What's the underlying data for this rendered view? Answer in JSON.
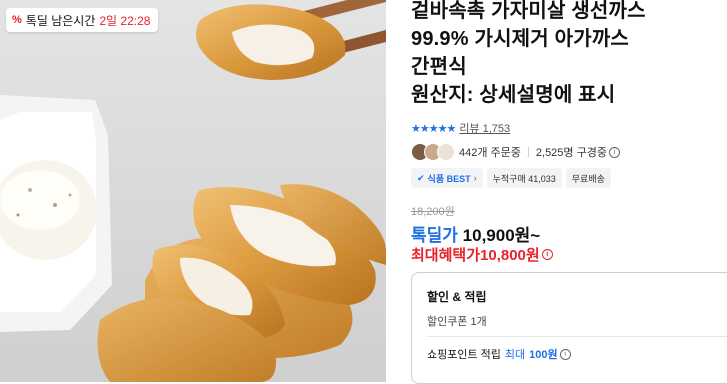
{
  "deal_timer": {
    "prefix": "톡딜 남은시간",
    "remaining": "2일 22:28"
  },
  "product": {
    "title": "겉바속촉 가자미살 생선까스\n99.9% 가시제거 아가까스\n간편식\n원산지: 상세설명에 표시",
    "rating": {
      "stars": 4.5,
      "star_glyphs": "★★★★★",
      "review_label": "리뷰 1,753"
    },
    "social": {
      "orders": "442개 주문중",
      "subscribers": "2,525명 구경중"
    },
    "badges": [
      "식품 BEST",
      "누적구매 41,033",
      "무료배송"
    ],
    "original_price": "18,200원",
    "deal_price_label": "톡딜가",
    "deal_price": "10,900원~",
    "max_benefit_label": "최대혜택가",
    "max_benefit_price": "10,800원"
  },
  "benefit_box": {
    "title": "할인 & 적립",
    "coupon": "할인쿠폰 1개",
    "points_label": "쇼핑포인트 적립",
    "points_max_label": "최대",
    "points_value": "100원"
  },
  "colors": {
    "accent_blue": "#1e6fe8",
    "accent_red": "#e8232b"
  }
}
